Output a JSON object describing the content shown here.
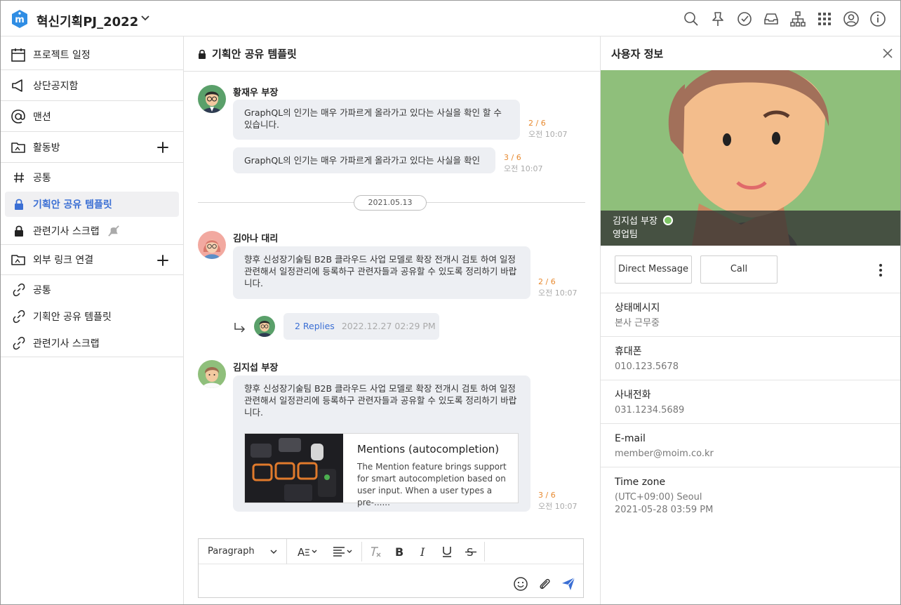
{
  "workspace": {
    "name": "혁신기획PJ_2022"
  },
  "top_icons": [
    "search-icon",
    "pin-icon",
    "check-circle-icon",
    "inbox-icon",
    "org-chart-icon",
    "apps-grid-icon",
    "user-circle-icon",
    "info-icon"
  ],
  "sidebar": {
    "schedule": "프로젝트 일정",
    "notice": "상단공지함",
    "mention": "맨션",
    "rooms_header": "활동방",
    "rooms": [
      {
        "label": "공통"
      },
      {
        "label": "기획안 공유 템플릿"
      },
      {
        "label": "관련기사 스크랩"
      }
    ],
    "links_header": "외부 링크 연결",
    "links": [
      {
        "label": "공통"
      },
      {
        "label": "기획안 공유 템플릿"
      },
      {
        "label": "관련기사 스크랩"
      }
    ]
  },
  "channel": {
    "title": "기획안 공유 템플릿",
    "messages": [
      {
        "author": "황재우 부장",
        "text1": "GraphQL의 인기는 매우 가파르게 올라가고 있다는 사실을 확인 할 수 있습니다.",
        "count1": "2 / 6",
        "time1": "오전 10:07",
        "text2": "GraphQL의 인기는 매우 가파르게 올라가고 있다는 사실을 확인",
        "count2": "3 / 6",
        "time2": "오전 10:07"
      },
      {
        "author": "김아나 대리",
        "text": "향후 신성장기술팀 B2B 클라우드 사업 모델로 확장 전개시 검토 하여 일정 관련해서 일정관리에 등록하구 관련자들과 공유할 수 있도록 정리하기 바랍니다.",
        "count": "2 / 6",
        "time": "오전 10:07"
      },
      {
        "author": "김지섭 부장",
        "text": "향후 신성장기술팀 B2B 클라우드 사업 모델로 확장 전개시 검토 하여 일정 관련해서 일정관리에 등록하구 관련자들과 공유할 수 있도록 정리하기 바랍니다.",
        "count": "3 / 6",
        "time": "오전 10:07"
      }
    ],
    "date_divider": "2021.05.13",
    "replies": {
      "count": "2 Replies",
      "date": "2022.12.27  02:29 PM"
    },
    "link_card": {
      "title": "Mentions (autocompletion)",
      "desc": "The Mention feature brings support for smart autocompletion based on user input. When a user types a pre-......"
    }
  },
  "editor": {
    "paragraph": "Paragraph"
  },
  "profile": {
    "header": "사용자 정보",
    "name": "김지섭 부장",
    "team": "영업팀",
    "dm_label": "Direct Message",
    "call_label": "Call",
    "fields": [
      {
        "label": "상태메시지",
        "value": "본사 근무중"
      },
      {
        "label": "휴대폰",
        "value": "010.123.5678"
      },
      {
        "label": "사내전화",
        "value": "031.1234.5689"
      },
      {
        "label": "E-mail",
        "value": "member@moim.co.kr"
      },
      {
        "label": "Time zone",
        "value": "(UTC+09:00) Seoul",
        "value2": "2021-05-28 03:59 PM"
      }
    ]
  },
  "colors": {
    "accent": "#3b6fd4",
    "count": "#e7892f",
    "bubble": "#edeff3",
    "online": "#7dc465"
  }
}
